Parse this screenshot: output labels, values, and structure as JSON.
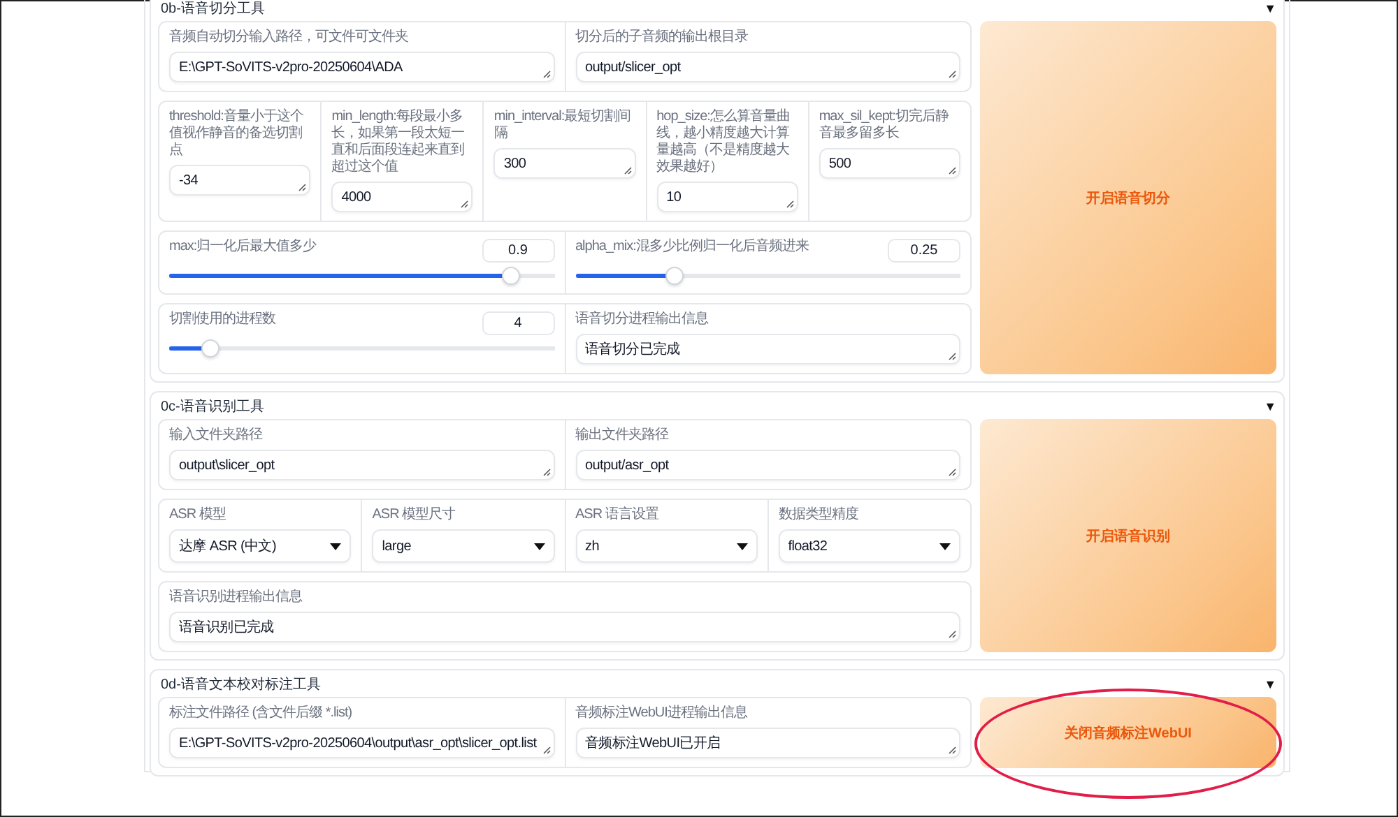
{
  "sections": [
    {
      "title": "0b-语音切分工具",
      "toggle": "▼",
      "groups": [
        {
          "fields": [
            {
              "kind": "textbox",
              "label": "音频自动切分输入路径，可文件可文件夹",
              "value": "E:\\GPT-SoVITS-v2pro-20250604\\ADA"
            },
            {
              "kind": "textbox",
              "label": "切分后的子音频的输出根目录",
              "value": "output/slicer_opt"
            }
          ]
        },
        {
          "fields": [
            {
              "kind": "textbox",
              "label": "threshold:音量小于这个值视作静音的备选切割点",
              "value": "-34"
            },
            {
              "kind": "textbox",
              "label": "min_length:每段最小多长，如果第一段太短一直和后面段连起来直到超过这个值",
              "value": "4000"
            },
            {
              "kind": "textbox",
              "label": "min_interval:最短切割间隔",
              "value": "300"
            },
            {
              "kind": "textbox",
              "label": "hop_size:怎么算音量曲线，越小精度越大计算量越高（不是精度越大效果越好）",
              "value": "10"
            },
            {
              "kind": "textbox",
              "label": "max_sil_kept:切完后静音最多留多长",
              "value": "500"
            }
          ]
        },
        {
          "fields": [
            {
              "kind": "slider",
              "label": "max:归一化后最大值多少",
              "value": "0.9",
              "level": 0.89
            },
            {
              "kind": "slider",
              "label": "alpha_mix:混多少比例归一化后音频进来",
              "value": "0.25",
              "level": 0.26
            }
          ]
        },
        {
          "fields": [
            {
              "kind": "slider",
              "label": "切割使用的进程数",
              "value": "4",
              "level": 0.11
            },
            {
              "kind": "textbox",
              "label": "语音切分进程输出信息",
              "value": "语音切分已完成"
            }
          ]
        }
      ],
      "button": {
        "label": "开启语音切分",
        "highlighted": false
      }
    },
    {
      "title": "0c-语音识别工具",
      "toggle": "▼",
      "groups": [
        {
          "fields": [
            {
              "kind": "textbox",
              "label": "输入文件夹路径",
              "value": "output\\slicer_opt"
            },
            {
              "kind": "textbox",
              "label": "输出文件夹路径",
              "value": "output/asr_opt"
            }
          ]
        },
        {
          "fields": [
            {
              "kind": "dropdown",
              "label": "ASR 模型",
              "value": "达摩 ASR (中文)"
            },
            {
              "kind": "dropdown",
              "label": "ASR 模型尺寸",
              "value": "large"
            },
            {
              "kind": "dropdown",
              "label": "ASR 语言设置",
              "value": "zh"
            },
            {
              "kind": "dropdown",
              "label": "数据类型精度",
              "value": "float32"
            }
          ]
        },
        {
          "fields": [
            {
              "kind": "textbox",
              "label": "语音识别进程输出信息",
              "value": "语音识别已完成"
            }
          ]
        }
      ],
      "button": {
        "label": "开启语音识别",
        "highlighted": false
      }
    },
    {
      "title": "0d-语音文本校对标注工具",
      "toggle": "▼",
      "groups": [
        {
          "fields": [
            {
              "kind": "textbox",
              "label": "标注文件路径 (含文件后缀 *.list)",
              "value": "E:\\GPT-SoVITS-v2pro-20250604\\output\\asr_opt\\slicer_opt.list"
            },
            {
              "kind": "textbox",
              "label": "音频标注WebUI进程输出信息",
              "value": "音频标注WebUI已开启"
            }
          ]
        }
      ],
      "button": {
        "label": "关闭音频标注WebUI",
        "highlighted": true
      }
    }
  ]
}
